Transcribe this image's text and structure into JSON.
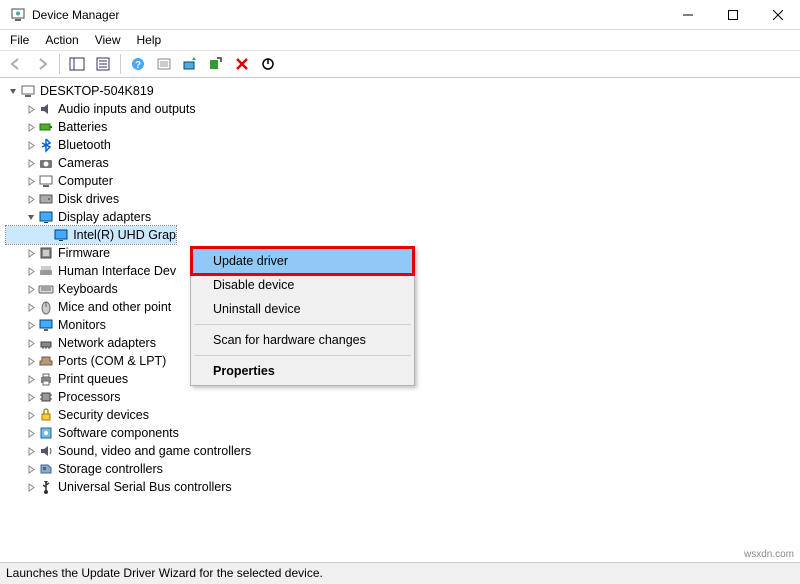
{
  "window": {
    "title": "Device Manager"
  },
  "menu": {
    "file": "File",
    "action": "Action",
    "view": "View",
    "help": "Help"
  },
  "tree": {
    "root": "DESKTOP-504K819",
    "nodes": [
      "Audio inputs and outputs",
      "Batteries",
      "Bluetooth",
      "Cameras",
      "Computer",
      "Disk drives",
      "Display adapters",
      "Firmware",
      "Human Interface Dev",
      "Keyboards",
      "Mice and other point",
      "Monitors",
      "Network adapters",
      "Ports (COM & LPT)",
      "Print queues",
      "Processors",
      "Security devices",
      "Software components",
      "Sound, video and game controllers",
      "Storage controllers",
      "Universal Serial Bus controllers"
    ],
    "selected_device": "Intel(R) UHD Grap"
  },
  "context_menu": {
    "update": "Update driver",
    "disable": "Disable device",
    "uninstall": "Uninstall device",
    "scan": "Scan for hardware changes",
    "properties": "Properties"
  },
  "statusbar": "Launches the Update Driver Wizard for the selected device.",
  "watermark": "wsxdn.com"
}
